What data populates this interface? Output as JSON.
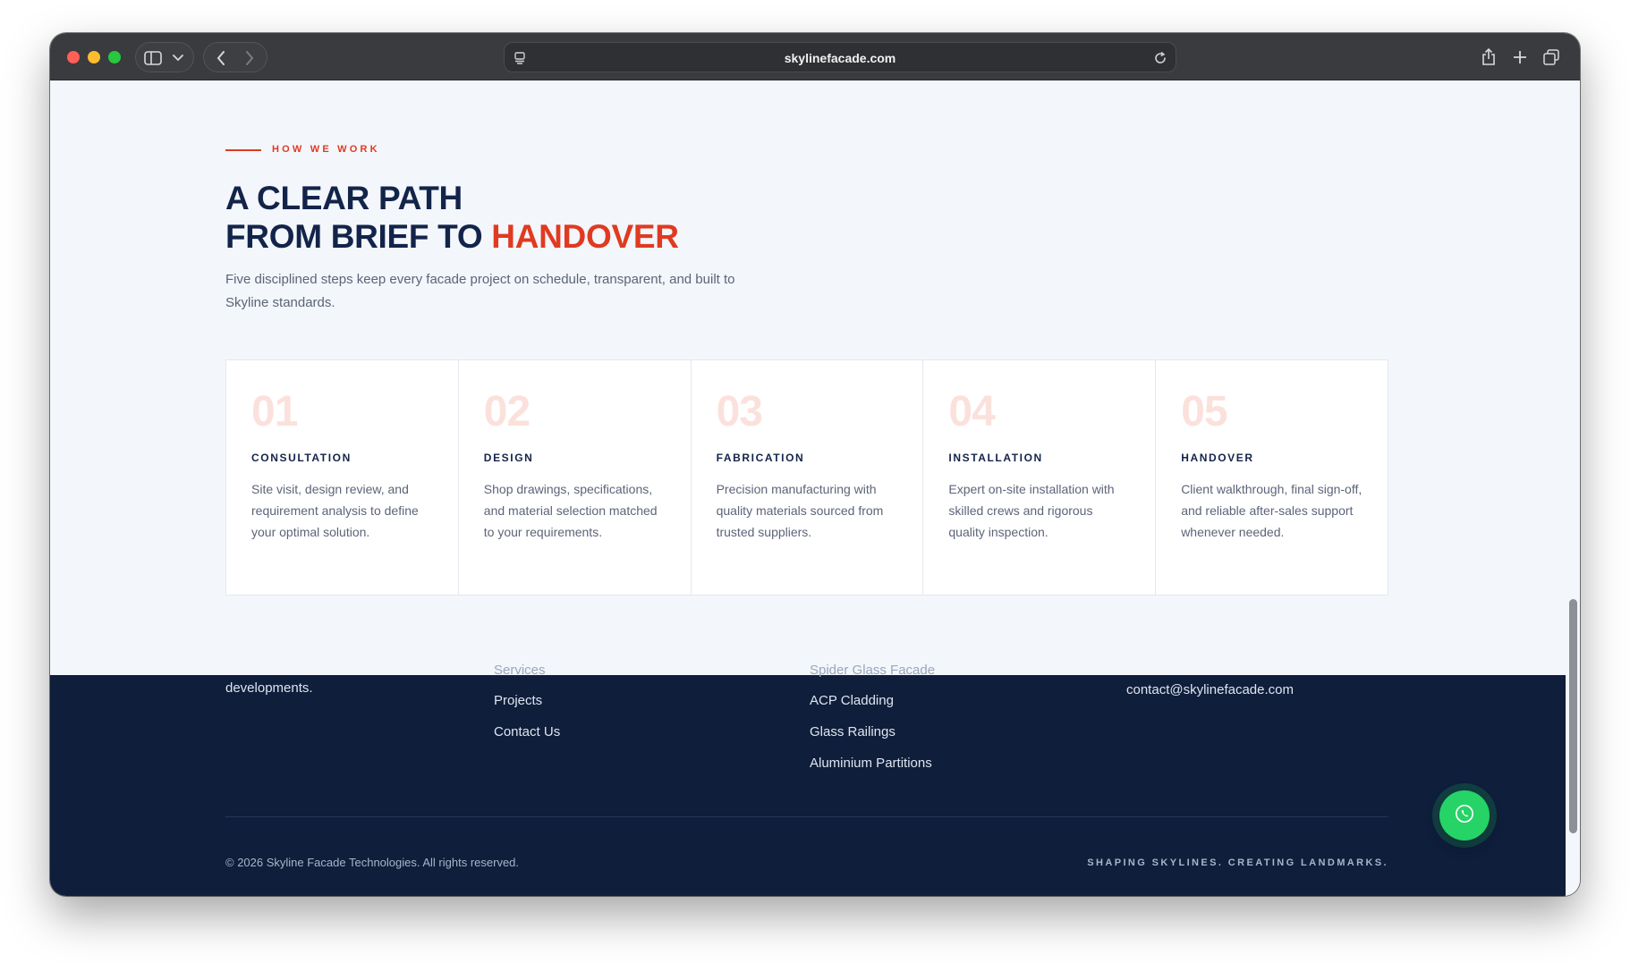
{
  "browser": {
    "url": "skylinefacade.com"
  },
  "process": {
    "eyebrow": "HOW WE WORK",
    "heading_line1": "A CLEAR PATH",
    "heading_line2_prefix": "FROM BRIEF TO ",
    "heading_line2_accent": "HANDOVER",
    "description": "Five disciplined steps keep every facade project on schedule, transparent, and built to Skyline standards.",
    "steps": [
      {
        "number": "01",
        "title": "CONSULTATION",
        "description": "Site visit, design review, and requirement analysis to define your optimal solution."
      },
      {
        "number": "02",
        "title": "DESIGN",
        "description": "Shop drawings, specifications, and material selection matched to your requirements."
      },
      {
        "number": "03",
        "title": "FABRICATION",
        "description": "Precision manufacturing with quality materials sourced from trusted suppliers."
      },
      {
        "number": "04",
        "title": "INSTALLATION",
        "description": "Expert on-site installation with skilled crews and rigorous quality inspection."
      },
      {
        "number": "05",
        "title": "HANDOVER",
        "description": "Client walkthrough, final sign-off, and reliable after-sales support whenever needed."
      }
    ]
  },
  "footer": {
    "about_text": "developments.",
    "links_partial": "Services",
    "links": [
      "Projects",
      "Contact Us"
    ],
    "services_partial": "Spider Glass Facade",
    "services": [
      "ACP Cladding",
      "Glass Railings",
      "Aluminium Partitions"
    ],
    "email": "contact@skylinefacade.com",
    "copyright": "© 2026 Skyline Facade Technologies. All rights reserved.",
    "tagline": "SHAPING SKYLINES. CREATING LANDMARKS."
  },
  "colors": {
    "navy": "#13244a",
    "accent": "#e03a21",
    "footer_bg": "#0e1e3b",
    "whatsapp": "#25d366"
  }
}
